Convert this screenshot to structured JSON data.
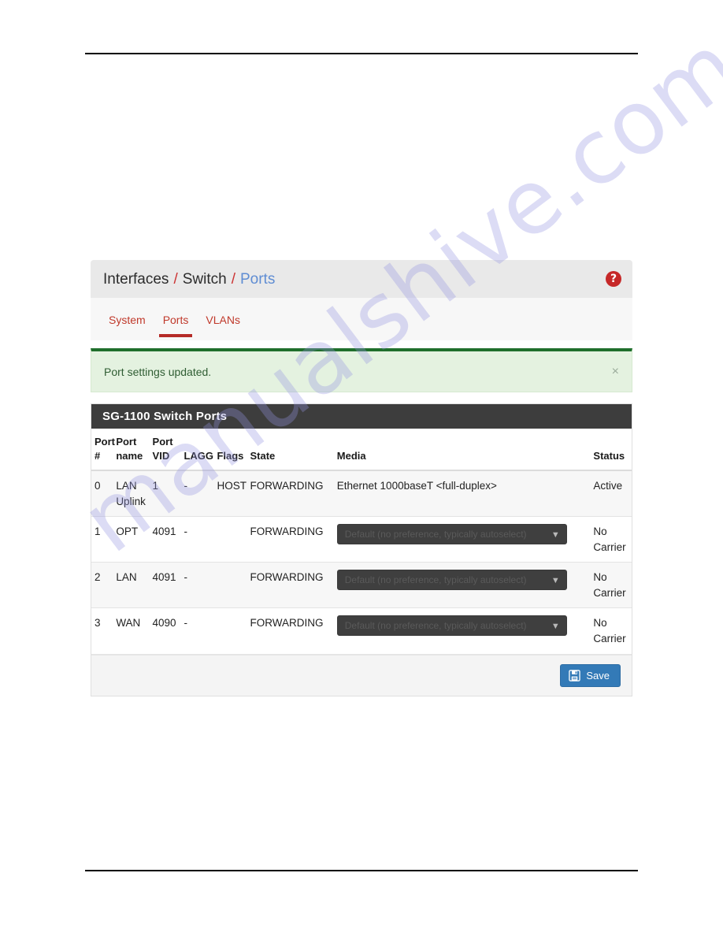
{
  "watermark": {
    "text": "manualshive.com"
  },
  "header": {
    "breadcrumb": [
      {
        "label": "Interfaces",
        "active": false
      },
      {
        "label": "Switch",
        "active": false
      },
      {
        "label": "Ports",
        "active": true
      }
    ],
    "separator": "/",
    "help_icon": "help-circle-icon",
    "help_glyph": "?"
  },
  "tabs": [
    {
      "label": "System",
      "active": false
    },
    {
      "label": "Ports",
      "active": true
    },
    {
      "label": "VLANs",
      "active": false
    }
  ],
  "alert": {
    "message": "Port settings updated.",
    "close_glyph": "×",
    "accent_color": "#1f6f2c",
    "background_color": "#e4f2e0"
  },
  "panel": {
    "title": "SG-1100 Switch Ports",
    "columns": [
      "Port #",
      "Port name",
      "Port VID",
      "LAGG",
      "Flags",
      "State",
      "Media",
      "Status"
    ],
    "columns_wrapped": [
      {
        "line1": "Port",
        "line2": "#"
      },
      {
        "line1": "Port",
        "line2": "name"
      },
      {
        "line1": "Port",
        "line2": "VID"
      },
      {
        "line1": "",
        "line2": "LAGG"
      },
      {
        "line1": "",
        "line2": "Flags"
      },
      {
        "line1": "",
        "line2": "State"
      },
      {
        "line1": "",
        "line2": "Media"
      },
      {
        "line1": "",
        "line2": "Status"
      }
    ],
    "rows": [
      {
        "port_num": "0",
        "port_name": "LAN Uplink",
        "port_vid": "1",
        "lagg": "-",
        "flags": "HOST",
        "state": "FORWARDING",
        "media_type": "text",
        "media": "Ethernet 1000baseT <full-duplex>",
        "status": "Active",
        "status_kind": "active",
        "striped": true
      },
      {
        "port_num": "1",
        "port_name": "OPT",
        "port_vid": "4091",
        "lagg": "-",
        "flags": "",
        "state": "FORWARDING",
        "media_type": "select",
        "media": "Default (no preference, typically autoselect)",
        "status": "No Carrier",
        "status_kind": "nocarrier",
        "striped": false
      },
      {
        "port_num": "2",
        "port_name": "LAN",
        "port_vid": "4091",
        "lagg": "-",
        "flags": "",
        "state": "FORWARDING",
        "media_type": "select",
        "media": "Default (no preference, typically autoselect)",
        "status": "No Carrier",
        "status_kind": "nocarrier",
        "striped": true
      },
      {
        "port_num": "3",
        "port_name": "WAN",
        "port_vid": "4090",
        "lagg": "-",
        "flags": "",
        "state": "FORWARDING",
        "media_type": "select",
        "media": "Default (no preference, typically autoselect)",
        "status": "No Carrier",
        "status_kind": "nocarrier",
        "striped": false
      }
    ],
    "save_button": {
      "label": "Save",
      "icon": "save-floppy-icon",
      "color": "#337ab7"
    }
  },
  "colors": {
    "breadcrumb_active": "#5f8dd3",
    "breadcrumb_separator": "#cc3333",
    "tab_text": "#c0392b",
    "tab_underline": "#b52b27",
    "status_active": "#35a455",
    "status_nocarrier": "#c0392b",
    "panel_heading_bg": "#3d3d3d"
  }
}
